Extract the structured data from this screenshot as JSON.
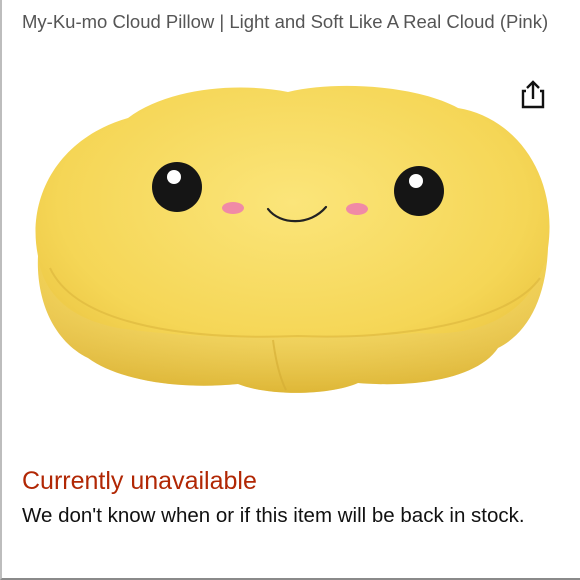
{
  "product": {
    "title": "My-Ku-mo Cloud Pillow | Light and Soft Like A Real Cloud (Pink)",
    "image_description_icon": "cloud-pillow-smiling-face"
  },
  "share": {
    "icon": "share-icon"
  },
  "availability": {
    "status": "Currently unavailable",
    "note": "We don't know when or if this item will be back in stock."
  },
  "colors": {
    "status_red": "#b12704",
    "title_gray": "#555555",
    "pillow_yellow": "#f6d95c",
    "cheek_pink": "#f08aa6"
  }
}
